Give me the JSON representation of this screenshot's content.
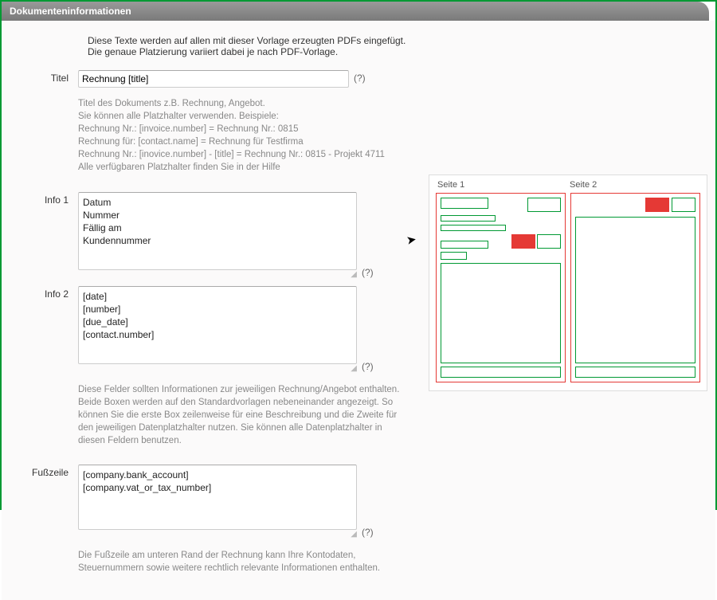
{
  "header": {
    "title": "Dokumenteninformationen"
  },
  "intro": "Diese Texte werden auf allen mit dieser Vorlage erzeugten PDFs eingefügt. Die genaue Platzierung variiert dabei je nach PDF-Vorlage.",
  "labels": {
    "titel": "Titel",
    "info1": "Info 1",
    "info2": "Info 2",
    "fusszeile": "Fußzeile",
    "help": "(?)"
  },
  "fields": {
    "titel_value": "Rechnung [title]",
    "info1_value": "Datum\nNummer\nFällig am\nKundennummer",
    "info2_value": "[date]\n[number]\n[due_date]\n[contact.number]",
    "fusszeile_value": "[company.bank_account]\n[company.vat_or_tax_number]"
  },
  "hints": {
    "titel": "Titel des Dokuments z.B. Rechnung, Angebot.\nSie können alle Platzhalter verwenden. Beispiele:\nRechnung Nr.: [invoice.number] = Rechnung Nr.: 0815\nRechnung für: [contact.name] = Rechnung für Testfirma\nRechnung Nr.: [inovice.number] - [title] = Rechnung Nr.: 0815 - Projekt 4711\nAlle verfügbaren Platzhalter finden Sie in der Hilfe",
    "info": "Diese Felder sollten Informationen zur jeweiligen Rechnung/Angebot enthalten. Beide Boxen werden auf den Standardvorlagen nebeneinander angezeigt. So können Sie die erste Box zeilenweise für eine Beschreibung und die Zweite für den jeweiligen Datenplatzhalter nutzen. Sie können alle Datenplatzhalter in diesen Feldern benutzen.",
    "fusszeile": "Die Fußzeile am unteren Rand der Rechnung kann Ihre Kontodaten, Steuernummern sowie weitere rechtlich relevante Informationen enthalten."
  },
  "preview": {
    "seite1": "Seite 1",
    "seite2": "Seite 2"
  },
  "colors": {
    "green": "#009933",
    "red": "#e53935",
    "grey": "#888888"
  }
}
